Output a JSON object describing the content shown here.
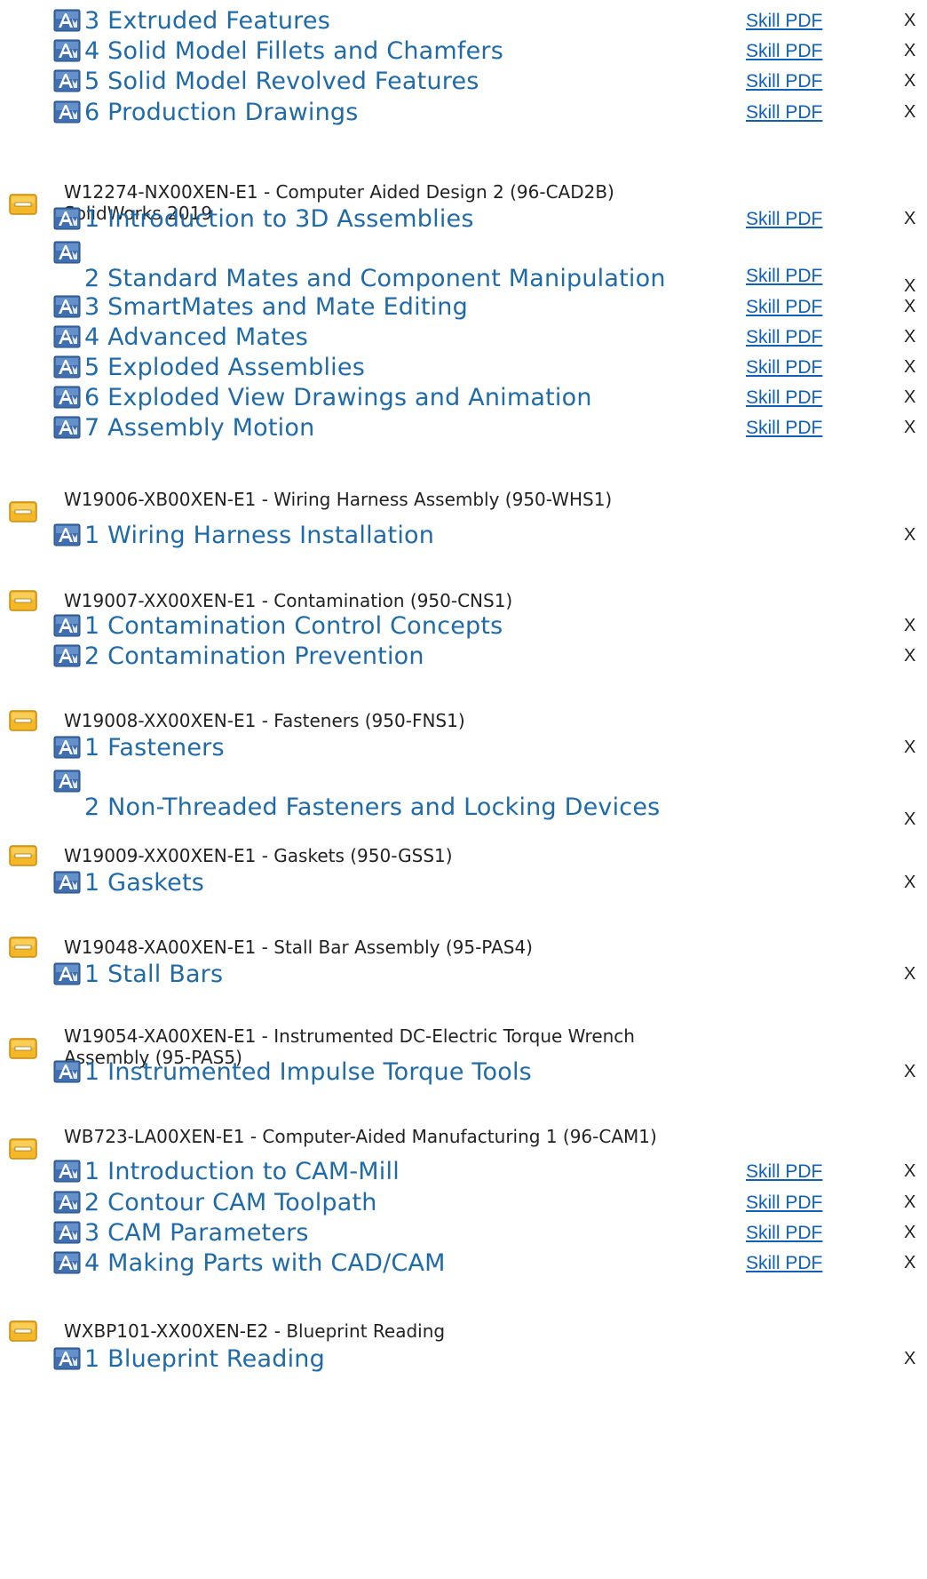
{
  "pdf_label": "Skill PDF",
  "remove_label": "X",
  "top_lessons": [
    {
      "title": "3 Extruded Features",
      "pdf": true
    },
    {
      "title": "4 Solid Model Fillets and Chamfers",
      "pdf": true
    },
    {
      "title": "5 Solid Model Revolved Features",
      "pdf": true
    },
    {
      "title": "6 Production Drawings",
      "pdf": true
    }
  ],
  "courses": [
    {
      "title": "W12274-NX00XEN-E1 - Computer Aided Design 2 (96-CAD2B) SolidWorks 2019",
      "lessons": [
        {
          "title": "1 Introduction to 3D Assemblies",
          "pdf": true
        },
        {
          "title": "2 Standard Mates and Component Manipulation",
          "pdf": true
        },
        {
          "title": "3 SmartMates and Mate Editing",
          "pdf": true
        },
        {
          "title": "4 Advanced Mates",
          "pdf": true
        },
        {
          "title": "5 Exploded Assemblies",
          "pdf": true
        },
        {
          "title": "6 Exploded View Drawings and Animation",
          "pdf": true
        },
        {
          "title": "7 Assembly Motion",
          "pdf": true
        }
      ]
    },
    {
      "title": "W19006-XB00XEN-E1 - Wiring Harness Assembly (950-WHS1)",
      "lessons": [
        {
          "title": "1 Wiring Harness Installation",
          "pdf": false
        }
      ]
    },
    {
      "title": "W19007-XX00XEN-E1 - Contamination (950-CNS1)",
      "lessons": [
        {
          "title": "1 Contamination Control Concepts",
          "pdf": false
        },
        {
          "title": "2 Contamination Prevention",
          "pdf": false
        }
      ]
    },
    {
      "title": "W19008-XX00XEN-E1 - Fasteners (950-FNS1)",
      "lessons": [
        {
          "title": "1 Fasteners",
          "pdf": false
        },
        {
          "title": "2 Non-Threaded Fasteners and Locking Devices",
          "pdf": false
        }
      ]
    },
    {
      "title": "W19009-XX00XEN-E1 - Gaskets (950-GSS1)",
      "lessons": [
        {
          "title": "1 Gaskets",
          "pdf": false
        }
      ]
    },
    {
      "title": "W19048-XA00XEN-E1 - Stall Bar Assembly (95-PAS4)",
      "lessons": [
        {
          "title": "1 Stall Bars",
          "pdf": false
        }
      ]
    },
    {
      "title": "W19054-XA00XEN-E1 - Instrumented DC-Electric Torque Wrench Assembly (95-PAS5)",
      "lessons": [
        {
          "title": "1 Instrumented Impulse Torque Tools",
          "pdf": false
        }
      ]
    },
    {
      "title": "WB723-LA00XEN-E1 - Computer-Aided Manufacturing 1 (96-CAM1)",
      "lessons": [
        {
          "title": "1 Introduction to CAM-Mill",
          "pdf": true
        },
        {
          "title": "2 Contour CAM Toolpath",
          "pdf": true
        },
        {
          "title": "3 CAM Parameters",
          "pdf": true
        },
        {
          "title": "4 Making Parts with CAD/CAM",
          "pdf": true
        }
      ]
    },
    {
      "title": "WXBP101-XX00XEN-E2 - Blueprint Reading",
      "lessons": [
        {
          "title": "1 Blueprint Reading",
          "pdf": false
        }
      ]
    }
  ]
}
